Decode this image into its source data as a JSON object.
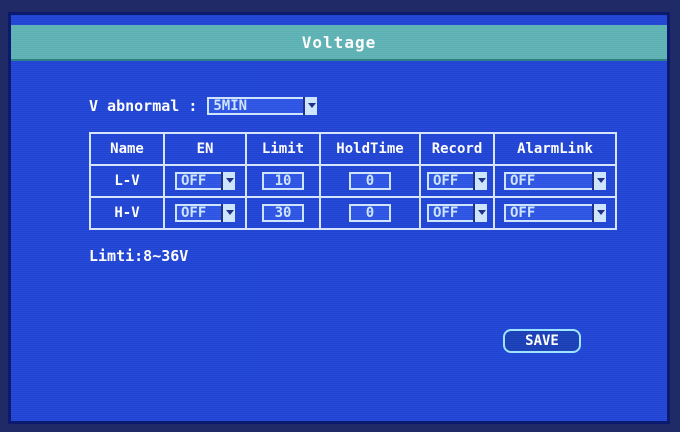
{
  "window": {
    "title": "Voltage"
  },
  "v_abnormal": {
    "label": "V abnormal :",
    "value": "5MIN"
  },
  "table": {
    "headers": [
      "Name",
      "EN",
      "Limit",
      "HoldTime",
      "Record",
      "AlarmLink"
    ],
    "rows": [
      {
        "name": "L-V",
        "en": "OFF",
        "limit": "10",
        "holdtime": "0",
        "record": "OFF",
        "alarmlink": "OFF"
      },
      {
        "name": "H-V",
        "en": "OFF",
        "limit": "30",
        "holdtime": "0",
        "record": "OFF",
        "alarmlink": "OFF"
      }
    ]
  },
  "limits_text": "Limti:8~36V",
  "buttons": {
    "save": "SAVE"
  },
  "colors": {
    "panel": "#2044d6",
    "titlebar": "#5fb3b6",
    "border": "#d7e6ff"
  }
}
